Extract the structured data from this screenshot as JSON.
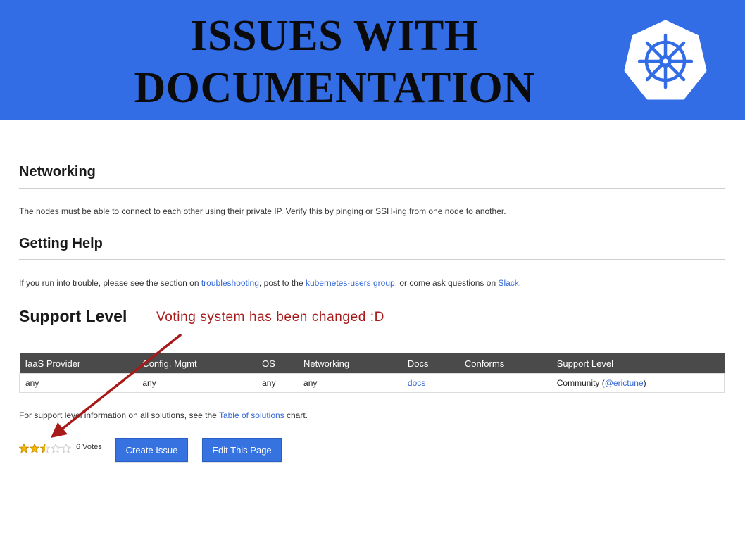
{
  "banner": {
    "title_line1": "ISSUES WITH",
    "title_line2": "DOCUMENTATION",
    "background_color": "#326de6",
    "logo_icon": "kubernetes-helm-icon"
  },
  "networking": {
    "heading": "Networking",
    "text": "The nodes must be able to connect to each other using their private IP. Verify this by pinging or SSH-ing from one node to another."
  },
  "getting_help": {
    "heading": "Getting Help",
    "text_1": "If you run into trouble, please see the section on ",
    "link_troubleshooting": "troubleshooting",
    "text_2": ", post to the ",
    "link_users_group": "kubernetes-users group",
    "text_3": ", or come ask questions on ",
    "link_slack": "Slack",
    "text_4": "."
  },
  "support_level": {
    "heading": "Support Level",
    "annotation": "Voting system has been changed :D",
    "annotation_color": "#a81919"
  },
  "table": {
    "headers": [
      "IaaS Provider",
      "Config. Mgmt",
      "OS",
      "Networking",
      "Docs",
      "Conforms",
      "Support Level"
    ],
    "row": {
      "iaas": "any",
      "config": "any",
      "os": "any",
      "networking": "any",
      "docs": "docs",
      "conforms": "",
      "support_prefix": "Community (",
      "support_link": "@erictune",
      "support_suffix": ")"
    }
  },
  "footer_text": {
    "prefix": "For support level information on all solutions, see the ",
    "link": "Table of solutions",
    "suffix": " chart."
  },
  "rating": {
    "value": 2.5,
    "max": 5,
    "votes_label": "6 Votes",
    "star_color": "#f5b400"
  },
  "buttons": {
    "create_issue": "Create Issue",
    "edit_page": "Edit This Page"
  },
  "link_color": "#3367d6"
}
